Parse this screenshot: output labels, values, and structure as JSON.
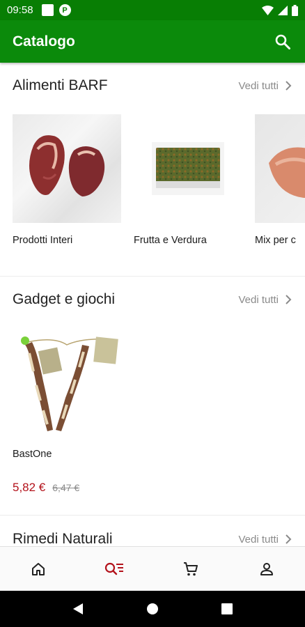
{
  "status_bar": {
    "time": "09:58"
  },
  "app_bar": {
    "title": "Catalogo"
  },
  "sections": [
    {
      "title": "Alimenti BARF",
      "see_all": "Vedi tutti",
      "items": [
        {
          "name": "Prodotti Interi"
        },
        {
          "name": "Frutta e Verdura"
        },
        {
          "name": "Mix per c"
        }
      ]
    },
    {
      "title": "Gadget e giochi",
      "see_all": "Vedi tutti",
      "items": [
        {
          "name": "BastOne",
          "price": "5,82 €",
          "old_price": "6,47 €"
        }
      ]
    },
    {
      "title": "Rimedi Naturali",
      "see_all": "Vedi tutti"
    }
  ],
  "bottom_nav": [
    "home-icon",
    "catalog-search-icon",
    "cart-icon",
    "account-icon"
  ],
  "colors": {
    "primary": "#0b8a0b",
    "status_bar": "#087e04",
    "accent_active": "#b3121b",
    "price": "#b3121b"
  }
}
